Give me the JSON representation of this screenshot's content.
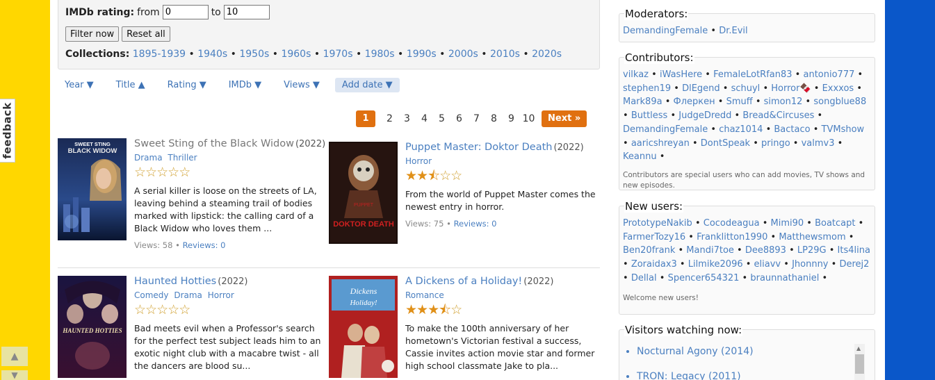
{
  "feedback_label": "feedback",
  "filter": {
    "imdb_label": "IMDb rating:",
    "from_label": "from",
    "from_value": "0",
    "to_label": "to",
    "to_value": "10",
    "filter_btn": "Filter now",
    "reset_btn": "Reset all",
    "collections_label": "Collections:",
    "collections": [
      "1895-1939",
      "1940s",
      "1950s",
      "1960s",
      "1970s",
      "1980s",
      "1990s",
      "2000s",
      "2010s",
      "2020s"
    ]
  },
  "sort": [
    {
      "label": "Year ▼",
      "active": false
    },
    {
      "label": "Title ▲",
      "active": false
    },
    {
      "label": "Rating ▼",
      "active": false
    },
    {
      "label": "IMDb ▼",
      "active": false
    },
    {
      "label": "Views ▼",
      "active": false
    },
    {
      "label": "Add date ▼",
      "active": true
    }
  ],
  "pager": {
    "current": "1",
    "pages": [
      "2",
      "3",
      "4",
      "5",
      "6",
      "7",
      "8",
      "9",
      "10"
    ],
    "next": "Next »"
  },
  "movies": [
    {
      "title": "Sweet Sting of the Black Widow",
      "year": "(2022)",
      "genres": [
        "Drama",
        "Thriller"
      ],
      "rating": 0,
      "stars": "☆☆☆☆☆",
      "desc": "A serial killer is loose on the streets of LA, leaving behind a steaming trail of bodies marked with lipstick: the calling card of a Black Widow who loves them ...",
      "views": "Views: 58",
      "reviews": "Reviews: 0"
    },
    {
      "title": "Puppet Master: Doktor Death",
      "year": "(2022)",
      "genres": [
        "Horror"
      ],
      "rating": 2.5,
      "stars": "★★⯪☆☆",
      "desc": "From the world of Puppet Master comes the newest entry in horror.",
      "views": "Views: 75",
      "reviews": "Reviews: 0"
    },
    {
      "title": "Haunted Hotties",
      "year": "(2022)",
      "genres": [
        "Comedy",
        "Drama",
        "Horror"
      ],
      "rating": 0,
      "stars": "☆☆☆☆☆",
      "desc": "Bad meets evil when a Professor's search for the perfect test subject leads him to an exotic night club with a macabre twist - all the dancers are blood su..."
    },
    {
      "title": "A Dickens of a Holiday!",
      "year": "(2022)",
      "genres": [
        "Romance"
      ],
      "rating": 3.5,
      "stars": "★★★⯪☆",
      "desc": "To make the 100th anniversary of her hometown's Victorian festival a success, Cassie invites action movie star and former high school classmate Jake to pla..."
    }
  ],
  "posters": [
    {
      "text1": "SWEET STING",
      "text2": "BLACK WIDOW"
    },
    {
      "text1": "PUPPET",
      "text2": "DOKTOR DEATH"
    },
    {
      "text1": "HAUNTED HOTTIES"
    },
    {
      "text1": "Dickens",
      "text2": "Holiday!"
    }
  ],
  "moderators": {
    "title": "Moderators:",
    "users": [
      "DemandingFemale",
      "Dr.Evil"
    ]
  },
  "contributors": {
    "title": "Contributors:",
    "users": [
      "vilkaz",
      "iWasHere",
      "FemaleLotRfan83",
      "antonio777",
      "stephen19",
      "DlEgend",
      "schuyl",
      "Horror🍫",
      "Exxxos",
      "Mark89a",
      "Флеркен",
      "Smuff",
      "simon12",
      "songblue88",
      "Buttless",
      "JudgeDredd",
      "Bread&Circuses",
      "DemandingFemale",
      "chaz1014",
      "Bactaco",
      "TVMshow",
      "aaricshreyan",
      "DontSpeak",
      "pringo",
      "valmv3",
      "Keannu"
    ],
    "note": "Contributors are special users who can add movies, TV shows and new episodes."
  },
  "new_users": {
    "title": "New users:",
    "users": [
      "PrototypeNakib",
      "Cocodeagua",
      "Mimi90",
      "Boatcapt",
      "FarmerTozy16",
      "Franklitton1990",
      "Matthewsmom",
      "Ben20frank",
      "Mandi7toe",
      "Dee8893",
      "LP29G",
      "Its4lina",
      "Zoraidax3",
      "Lilmike2096",
      "eliavv",
      "Jhonnny",
      "Derej2",
      "Dellal",
      "Spencer654321",
      "braunnathaniel"
    ],
    "note": "Welcome new users!"
  },
  "visitors": {
    "title": "Visitors watching now:",
    "items": [
      "Nocturnal Agony (2014)",
      "TRON: Legacy (2011)"
    ]
  }
}
